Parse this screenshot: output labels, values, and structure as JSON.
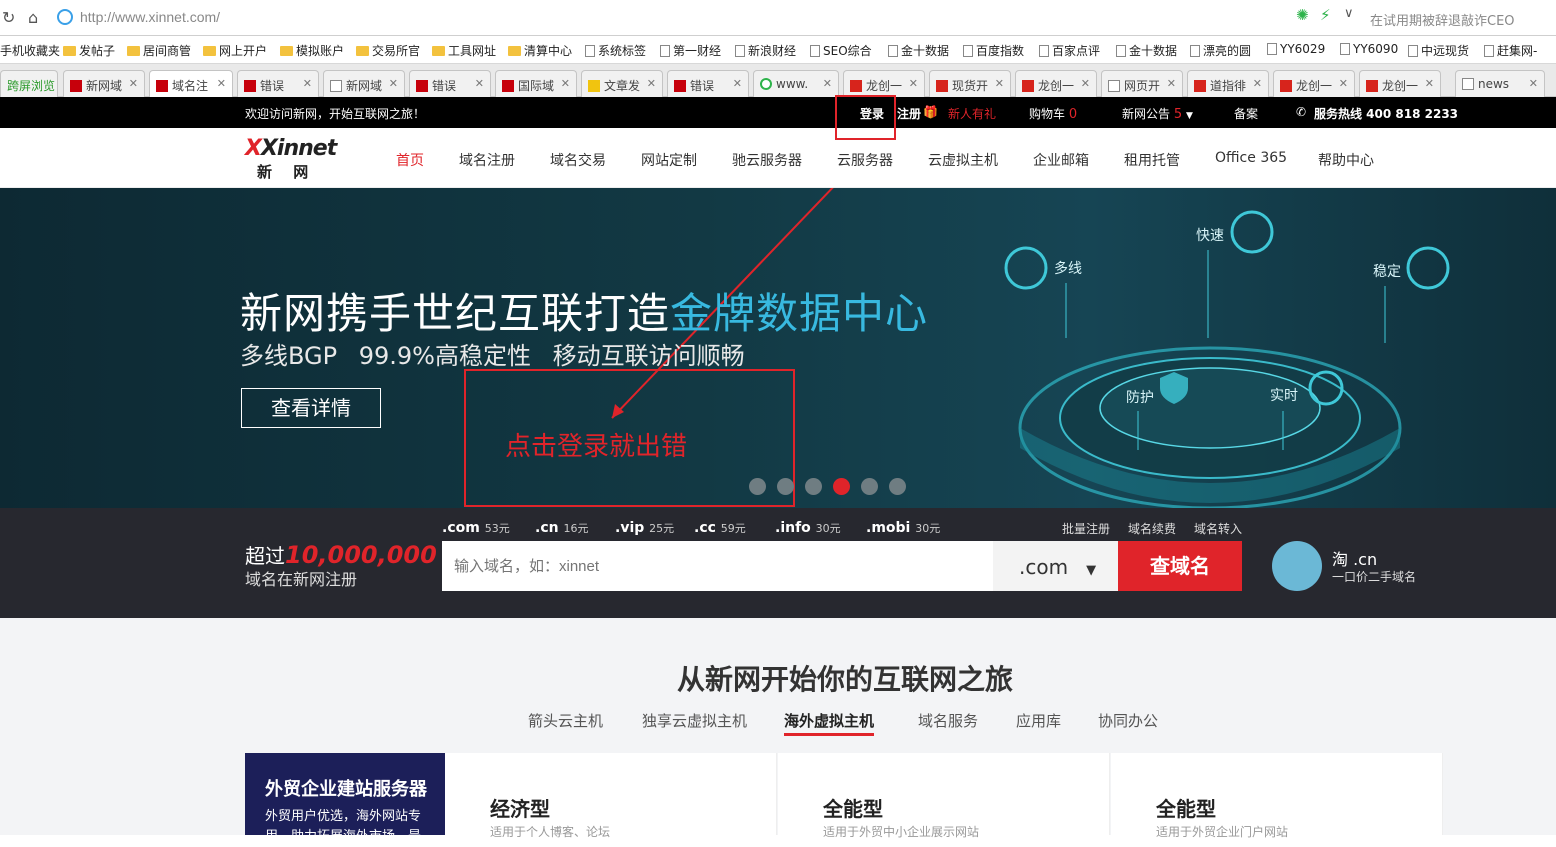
{
  "browser": {
    "url": "http://www.xinnet.com/",
    "search_text": "在试用期被辞退敲诈CEO",
    "bookmarks": [
      "手机收藏夹",
      "发帖子",
      "居间商管",
      "网上开户",
      "模拟账户",
      "交易所官",
      "工具网址",
      "清算中心",
      "系统标签",
      "第一财经",
      "新浪财经",
      "SEO综合",
      "金十数据",
      "百度指数",
      "百家点评",
      "金十数据",
      "漂亮的圆",
      "YY6029",
      "YY6090",
      "中远现货",
      "赶集网-"
    ],
    "tabs": [
      "跨屏浏览",
      "新网域",
      "域名注",
      "错误",
      "新网域",
      "错误",
      "国际域",
      "文章发",
      "错误",
      "www.",
      "龙创一",
      "现货开",
      "龙创一",
      "网页开",
      "道指徘",
      "龙创一",
      "龙创一",
      "news"
    ]
  },
  "topbar": {
    "welcome": "欢迎访问新网，开始互联网之旅！",
    "login": "登录",
    "register": "注册",
    "gift": "新人有礼",
    "cart": "购物车",
    "cart_count": "0",
    "notice": "新网公告",
    "notice_count": "5",
    "beian": "备案",
    "hotline": "服务热线 400 818 2233"
  },
  "logo": {
    "en": "Xinnet",
    "cn": "新 网"
  },
  "nav": [
    "首页",
    "域名注册",
    "域名交易",
    "网站定制",
    "驰云服务器",
    "云服务器",
    "云虚拟主机",
    "企业邮箱",
    "租用托管",
    "Office 365",
    "帮助中心"
  ],
  "banner": {
    "title_pre": "新网携手世纪互联打造",
    "title_hl": "金牌数据中心",
    "subtitle": "多线BGP   99.9%高稳定性   移动互联访问顺畅",
    "button": "查看详情",
    "features": [
      "多线",
      "快速",
      "稳定",
      "防护",
      "实时"
    ],
    "active_dot": 4,
    "dot_count": 6
  },
  "annotation": {
    "text": "点击登录就出错"
  },
  "domain_search": {
    "line1_pre": "超过",
    "line1_num": "10,000,000",
    "line2": "域名在新网注册",
    "extensions": [
      {
        "ext": ".com",
        "price": "53元"
      },
      {
        "ext": ".cn",
        "price": "16元"
      },
      {
        "ext": ".vip",
        "price": "25元"
      },
      {
        "ext": ".cc",
        "price": "59元"
      },
      {
        "ext": ".info",
        "price": "30元"
      },
      {
        "ext": ".mobi",
        "price": "30元"
      }
    ],
    "links": [
      "批量注册",
      "域名续费",
      "域名转入"
    ],
    "placeholder": "输入域名，如：xinnet",
    "selected": ".com",
    "button": "查域名",
    "tao_title": "淘 .cn",
    "tao_sub": "一口价二手域名"
  },
  "lower": {
    "title": "从新网开始你的互联网之旅",
    "tabs": [
      "箭头云主机",
      "独享云虚拟主机",
      "海外虚拟主机",
      "域名服务",
      "应用库",
      "协同办公"
    ],
    "active_tab": 2,
    "card_feature_title": "外贸企业建站服务器",
    "card_feature_sub": "外贸用户优选，海外网站专用，助力拓展海外市场，是",
    "cards": [
      {
        "title": "经济型",
        "sub": "适用于个人博客、论坛"
      },
      {
        "title": "全能型",
        "sub": "适用于外贸中小企业展示网站"
      },
      {
        "title": "全能型",
        "sub": "适用于外贸企业门户网站"
      }
    ]
  }
}
